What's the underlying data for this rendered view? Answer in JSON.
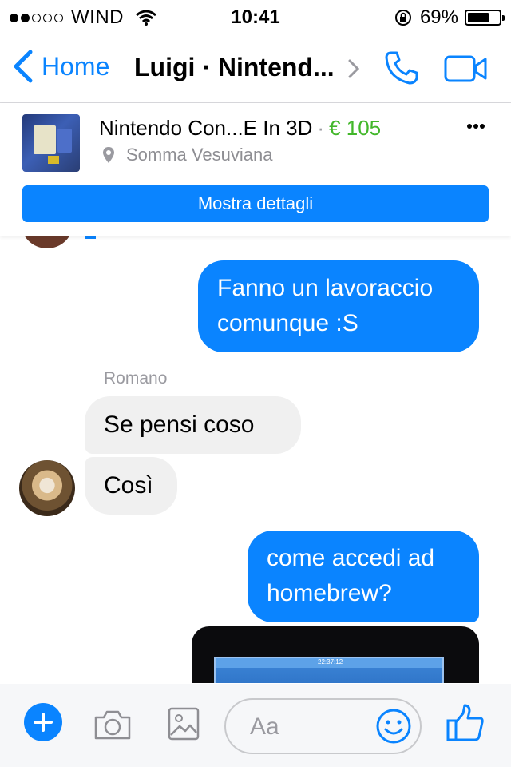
{
  "status_bar": {
    "signal_filled": 2,
    "signal_total": 5,
    "carrier": "WIND",
    "time": "10:41",
    "battery": "69%",
    "battery_level": 0.69
  },
  "nav": {
    "back_label": "Home",
    "title": "Luigi · Nintend..."
  },
  "product": {
    "title": "Nintendo  Con...E In 3D",
    "separator": "·",
    "price": "€ 105",
    "location": "Somma Vesuviana",
    "details_button": "Mostra dettagli"
  },
  "messages": {
    "out_1": [
      "Fanno un lavoraccio",
      "comunque :S"
    ],
    "sender": "Romano",
    "in_1": "Se pensi  coso",
    "in_2": "Così",
    "out_2": [
      "come accedi ad",
      "homebrew?"
    ],
    "photo_time": "22:37:12"
  },
  "composer": {
    "placeholder": "Aa"
  },
  "colors": {
    "accent": "#0a84ff",
    "price": "#42b72a",
    "incoming_bubble": "#f0f0f0"
  },
  "icons": [
    "wifi-icon",
    "rotation-lock-icon",
    "back-chevron-icon",
    "call-icon",
    "video-call-icon",
    "more-icon",
    "location-pin-icon",
    "plus-icon",
    "camera-icon",
    "gallery-icon",
    "emoji-icon",
    "like-icon"
  ]
}
